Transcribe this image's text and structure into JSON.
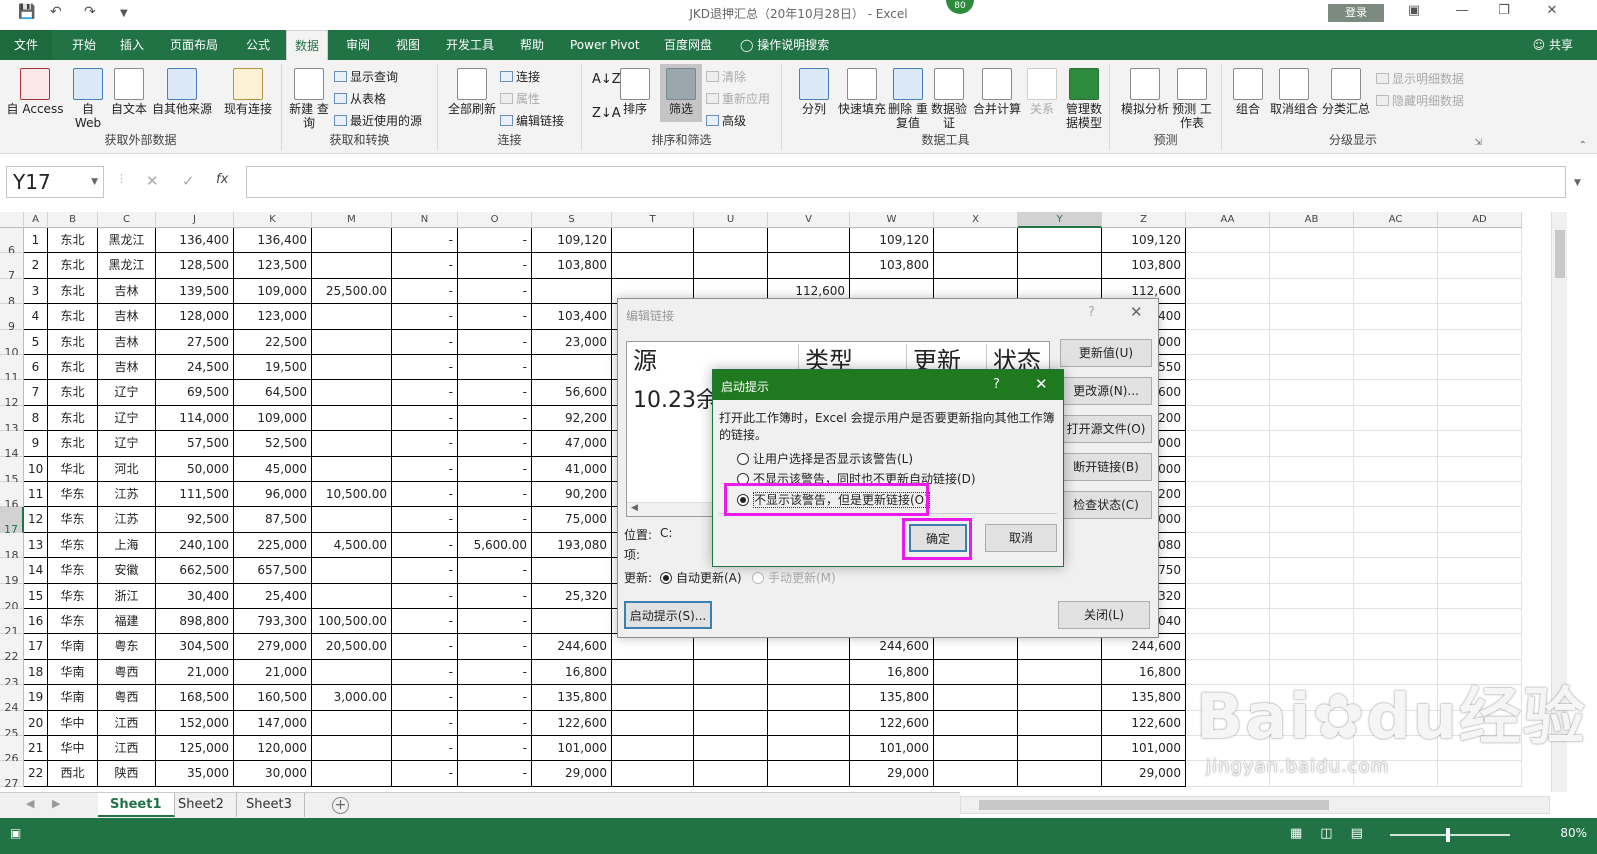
{
  "window": {
    "title": "JKD退押汇总（20年10月28日） - Excel",
    "login": "登录",
    "badge": "80"
  },
  "ribbon_tabs": [
    "文件",
    "开始",
    "插入",
    "页面布局",
    "公式",
    "数据",
    "审阅",
    "视图",
    "开发工具",
    "帮助",
    "Power Pivot",
    "百度网盘",
    "操作说明搜索"
  ],
  "share": "共享",
  "ribbon": {
    "get_external": {
      "label": "获取外部数据",
      "buttons": [
        "自 Access",
        "自 Web",
        "自文本",
        "自其他来源",
        "现有连接"
      ]
    },
    "get_transform": {
      "label": "获取和转换",
      "new_query": "新建 查询",
      "small": [
        "显示查询",
        "从表格",
        "最近使用的源"
      ]
    },
    "connections": {
      "label": "连接",
      "refresh_all": "全部刷新",
      "small": [
        "连接",
        "属性",
        "编辑链接"
      ]
    },
    "sort_filter": {
      "label": "排序和筛选",
      "sort": "排序",
      "filter": "筛选",
      "small": [
        "清除",
        "重新应用",
        "高级"
      ]
    },
    "data_tools": {
      "label": "数据工具",
      "buttons": [
        "分列",
        "快速填充",
        "删除 重复值",
        "数据验 证",
        "合并计算",
        "关系",
        "管理数 据模型"
      ]
    },
    "forecast": {
      "label": "预测",
      "buttons": [
        "模拟分析",
        "预测 工作表"
      ]
    },
    "outline": {
      "label": "分级显示",
      "buttons": [
        "组合",
        "取消组合",
        "分类汇总"
      ],
      "small": [
        "显示明细数据",
        "隐藏明细数据"
      ]
    }
  },
  "formula_bar": {
    "name_box": "Y17",
    "fx": "fx",
    "content": ""
  },
  "columns": [
    "A",
    "B",
    "C",
    "J",
    "K",
    "M",
    "N",
    "O",
    "S",
    "T",
    "U",
    "V",
    "W",
    "X",
    "Y",
    "Z",
    "AA",
    "AB",
    "AC",
    "AD"
  ],
  "selected_column": "Y",
  "selected_row": 17,
  "rows": [
    {
      "n": 6,
      "cells": [
        "1",
        "东北",
        "黑龙江",
        "136,400",
        "136,400",
        "",
        "-",
        "-",
        "109,120",
        "",
        "",
        "",
        "109,120",
        "",
        "",
        "109,120"
      ]
    },
    {
      "n": 7,
      "cells": [
        "2",
        "东北",
        "黑龙江",
        "128,500",
        "123,500",
        "",
        "-",
        "-",
        "103,800",
        "",
        "",
        "",
        "103,800",
        "",
        "",
        "103,800"
      ]
    },
    {
      "n": 8,
      "cells": [
        "3",
        "东北",
        "吉林",
        "139,500",
        "109,000",
        "25,500.00",
        "-",
        "-",
        "",
        "",
        "",
        "112,600",
        "",
        "",
        "",
        "112,600"
      ]
    },
    {
      "n": 9,
      "cells": [
        "4",
        "东北",
        "吉林",
        "128,000",
        "123,000",
        "",
        "-",
        "-",
        "103,400",
        "",
        "",
        "",
        "",
        "",
        "",
        "103,400"
      ]
    },
    {
      "n": 10,
      "cells": [
        "5",
        "东北",
        "吉林",
        "27,500",
        "22,500",
        "",
        "-",
        "-",
        "23,000",
        "",
        "",
        "",
        "",
        "",
        "",
        "23,000"
      ]
    },
    {
      "n": 11,
      "cells": [
        "6",
        "东北",
        "吉林",
        "24,500",
        "19,500",
        "",
        "-",
        "-",
        "",
        "",
        "",
        "",
        "",
        "",
        "",
        "19,550"
      ]
    },
    {
      "n": 12,
      "cells": [
        "7",
        "东北",
        "辽宁",
        "69,500",
        "64,500",
        "",
        "-",
        "-",
        "56,600",
        "",
        "",
        "",
        "",
        "",
        "",
        "56,600"
      ]
    },
    {
      "n": 13,
      "cells": [
        "8",
        "东北",
        "辽宁",
        "114,000",
        "109,000",
        "",
        "-",
        "-",
        "92,200",
        "",
        "",
        "",
        "",
        "",
        "",
        "92,200"
      ]
    },
    {
      "n": 14,
      "cells": [
        "9",
        "东北",
        "辽宁",
        "57,500",
        "52,500",
        "",
        "-",
        "-",
        "47,000",
        "",
        "",
        "",
        "",
        "",
        "",
        "47,000"
      ]
    },
    {
      "n": 15,
      "cells": [
        "10",
        "华北",
        "河北",
        "50,000",
        "45,000",
        "",
        "-",
        "-",
        "41,000",
        "",
        "",
        "",
        "",
        "",
        "",
        "41,000"
      ]
    },
    {
      "n": 16,
      "cells": [
        "11",
        "华东",
        "江苏",
        "111,500",
        "96,000",
        "10,500.00",
        "-",
        "-",
        "90,200",
        "",
        "",
        "",
        "",
        "",
        "",
        "90,200"
      ]
    },
    {
      "n": 17,
      "cells": [
        "12",
        "华东",
        "江苏",
        "92,500",
        "87,500",
        "",
        "-",
        "-",
        "75,000",
        "",
        "",
        "",
        "",
        "",
        "",
        "75,000"
      ]
    },
    {
      "n": 18,
      "cells": [
        "13",
        "华东",
        "上海",
        "240,100",
        "225,000",
        "4,500.00",
        "-",
        "5,600.00",
        "193,080",
        "",
        "",
        "",
        "",
        "",
        "",
        "193,080"
      ]
    },
    {
      "n": 19,
      "cells": [
        "14",
        "华东",
        "安徽",
        "662,500",
        "657,500",
        "",
        "-",
        "-",
        "",
        "",
        "",
        "",
        "",
        "",
        "",
        "657,750"
      ]
    },
    {
      "n": 20,
      "cells": [
        "15",
        "华东",
        "浙江",
        "30,400",
        "25,400",
        "",
        "-",
        "-",
        "25,320",
        "",
        "",
        "",
        "",
        "",
        "",
        "25,320"
      ]
    },
    {
      "n": 21,
      "cells": [
        "16",
        "华东",
        "福建",
        "898,800",
        "793,300",
        "100,500.00",
        "-",
        "-",
        "",
        "",
        "",
        "",
        "",
        "",
        "",
        "793,040"
      ]
    },
    {
      "n": 22,
      "cells": [
        "17",
        "华南",
        "粤东",
        "304,500",
        "279,000",
        "20,500.00",
        "-",
        "-",
        "244,600",
        "",
        "",
        "",
        "244,600",
        "",
        "",
        "244,600"
      ]
    },
    {
      "n": 23,
      "cells": [
        "18",
        "华南",
        "粤西",
        "21,000",
        "21,000",
        "",
        "-",
        "-",
        "16,800",
        "",
        "",
        "",
        "16,800",
        "",
        "",
        "16,800"
      ]
    },
    {
      "n": 24,
      "cells": [
        "19",
        "华南",
        "粤西",
        "168,500",
        "160,500",
        "3,000.00",
        "-",
        "-",
        "135,800",
        "",
        "",
        "",
        "135,800",
        "",
        "",
        "135,800"
      ]
    },
    {
      "n": 25,
      "cells": [
        "20",
        "华中",
        "江西",
        "152,000",
        "147,000",
        "",
        "-",
        "-",
        "122,600",
        "",
        "",
        "",
        "122,600",
        "",
        "",
        "122,600"
      ]
    },
    {
      "n": 26,
      "cells": [
        "21",
        "华中",
        "江西",
        "125,000",
        "120,000",
        "",
        "-",
        "-",
        "101,000",
        "",
        "",
        "",
        "101,000",
        "",
        "",
        "101,000"
      ]
    },
    {
      "n": 27,
      "cells": [
        "22",
        "西北",
        "陕西",
        "35,000",
        "30,000",
        "",
        "-",
        "-",
        "29,000",
        "",
        "",
        "",
        "29,000",
        "",
        "",
        "29,000"
      ]
    }
  ],
  "sheets": [
    "Sheet1",
    "Sheet2",
    "Sheet3"
  ],
  "active_sheet": "Sheet1",
  "zoom": "80%",
  "edit_links_dialog": {
    "title": "编辑链接",
    "help": "?",
    "close": "✕",
    "headers": [
      "源",
      "类型",
      "更新",
      "状态"
    ],
    "link_source": "10.23余",
    "buttons": [
      "更新值(U)",
      "更改源(N)...",
      "打开源文件(O)",
      "断开链接(B)",
      "检查状态(C)"
    ],
    "location_label": "位置:",
    "location_value": "C:",
    "item_label": "项:",
    "update_label": "更新:",
    "auto_update": "自动更新(A)",
    "manual_update": "手动更新(M)",
    "startup_button": "启动提示(S)...",
    "close_button": "关闭(L)"
  },
  "startup_dialog": {
    "title": "启动提示",
    "help": "?",
    "close": "✕",
    "message": "打开此工作簿时，Excel 会提示用户是否要更新指向其他工作簿的链接。",
    "options": [
      "让用户选择是否显示该警告(L)",
      "不显示该警告，同时也不更新自动链接(D)",
      "不显示该警告，但是更新链接(O)"
    ],
    "selected_option": 2,
    "ok": "确定",
    "cancel": "取消"
  },
  "watermark": {
    "main": "Bai",
    "main2": "du",
    "main3": "经验",
    "sub": "jingyan.baidu.com"
  }
}
